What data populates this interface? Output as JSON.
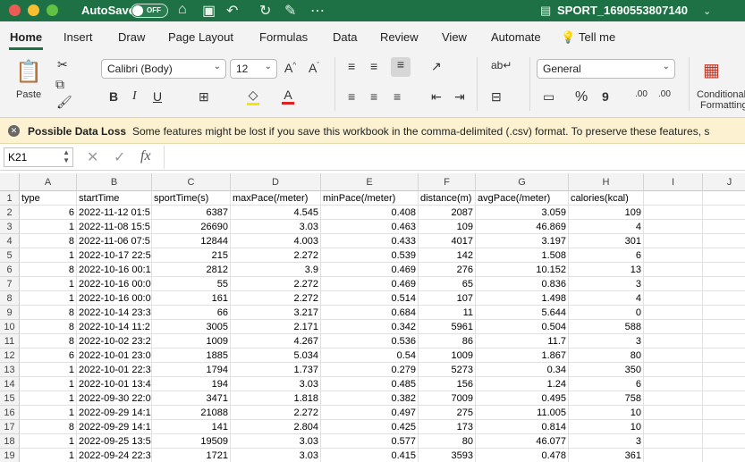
{
  "titlebar": {
    "autosave_label": "AutoSave",
    "toggle_label": "OFF",
    "filename": "SPORT_1690553807140"
  },
  "menu": [
    "Home",
    "Insert",
    "Draw",
    "Page Layout",
    "Formulas",
    "Data",
    "Review",
    "View",
    "Automate",
    "Tell me"
  ],
  "ribbon": {
    "paste_label": "Paste",
    "font_name": "Calibri (Body)",
    "font_size": "12",
    "number_format": "General",
    "conditional_label": "Conditional",
    "formatting_label": "Formatting",
    "bold": "B",
    "italic": "I",
    "underline": "U",
    "increase_font": "A^",
    "decrease_font": "A^",
    "percent": "%",
    "comma": "9",
    "inc_decimal": ".00",
    "dec_decimal": ".00"
  },
  "banner": {
    "title": "Possible Data Loss",
    "message": "Some features might be lost if you save this workbook in the comma-delimited (.csv) format. To preserve these features, s"
  },
  "formula_bar": {
    "cell_ref": "K21",
    "fx": "fx",
    "content": ""
  },
  "columns": [
    "A",
    "B",
    "C",
    "D",
    "E",
    "F",
    "G",
    "H",
    "I",
    "J"
  ],
  "rows": [
    [
      "type",
      "startTime",
      "sportTime(s)",
      "maxPace(/meter)",
      "minPace(/meter)",
      "distance(m)",
      "avgPace(/meter)",
      "calories(kcal)"
    ],
    [
      "6",
      "2022-11-12 01:5",
      "6387",
      "4.545",
      "0.408",
      "2087",
      "3.059",
      "109"
    ],
    [
      "1",
      "2022-11-08 15:5",
      "26690",
      "3.03",
      "0.463",
      "109",
      "46.869",
      "4"
    ],
    [
      "8",
      "2022-11-06 07:5",
      "12844",
      "4.003",
      "0.433",
      "4017",
      "3.197",
      "301"
    ],
    [
      "1",
      "2022-10-17 22:5",
      "215",
      "2.272",
      "0.539",
      "142",
      "1.508",
      "6"
    ],
    [
      "8",
      "2022-10-16 00:1",
      "2812",
      "3.9",
      "0.469",
      "276",
      "10.152",
      "13"
    ],
    [
      "1",
      "2022-10-16 00:0",
      "55",
      "2.272",
      "0.469",
      "65",
      "0.836",
      "3"
    ],
    [
      "1",
      "2022-10-16 00:0",
      "161",
      "2.272",
      "0.514",
      "107",
      "1.498",
      "4"
    ],
    [
      "8",
      "2022-10-14 23:3",
      "66",
      "3.217",
      "0.684",
      "11",
      "5.644",
      "0"
    ],
    [
      "8",
      "2022-10-14 11:2",
      "3005",
      "2.171",
      "0.342",
      "5961",
      "0.504",
      "588"
    ],
    [
      "8",
      "2022-10-02 23:2",
      "1009",
      "4.267",
      "0.536",
      "86",
      "11.7",
      "3"
    ],
    [
      "6",
      "2022-10-01 23:0",
      "1885",
      "5.034",
      "0.54",
      "1009",
      "1.867",
      "80"
    ],
    [
      "1",
      "2022-10-01 22:3",
      "1794",
      "1.737",
      "0.279",
      "5273",
      "0.34",
      "350"
    ],
    [
      "1",
      "2022-10-01 13:4",
      "194",
      "3.03",
      "0.485",
      "156",
      "1.24",
      "6"
    ],
    [
      "1",
      "2022-09-30 22:0",
      "3471",
      "1.818",
      "0.382",
      "7009",
      "0.495",
      "758"
    ],
    [
      "1",
      "2022-09-29 14:1",
      "21088",
      "2.272",
      "0.497",
      "275",
      "11.005",
      "10"
    ],
    [
      "8",
      "2022-09-29 14:1",
      "141",
      "2.804",
      "0.425",
      "173",
      "0.814",
      "10"
    ],
    [
      "1",
      "2022-09-25 13:5",
      "19509",
      "3.03",
      "0.577",
      "80",
      "46.077",
      "3"
    ],
    [
      "1",
      "2022-09-24 22:3",
      "1721",
      "3.03",
      "0.415",
      "3593",
      "0.478",
      "361"
    ]
  ]
}
